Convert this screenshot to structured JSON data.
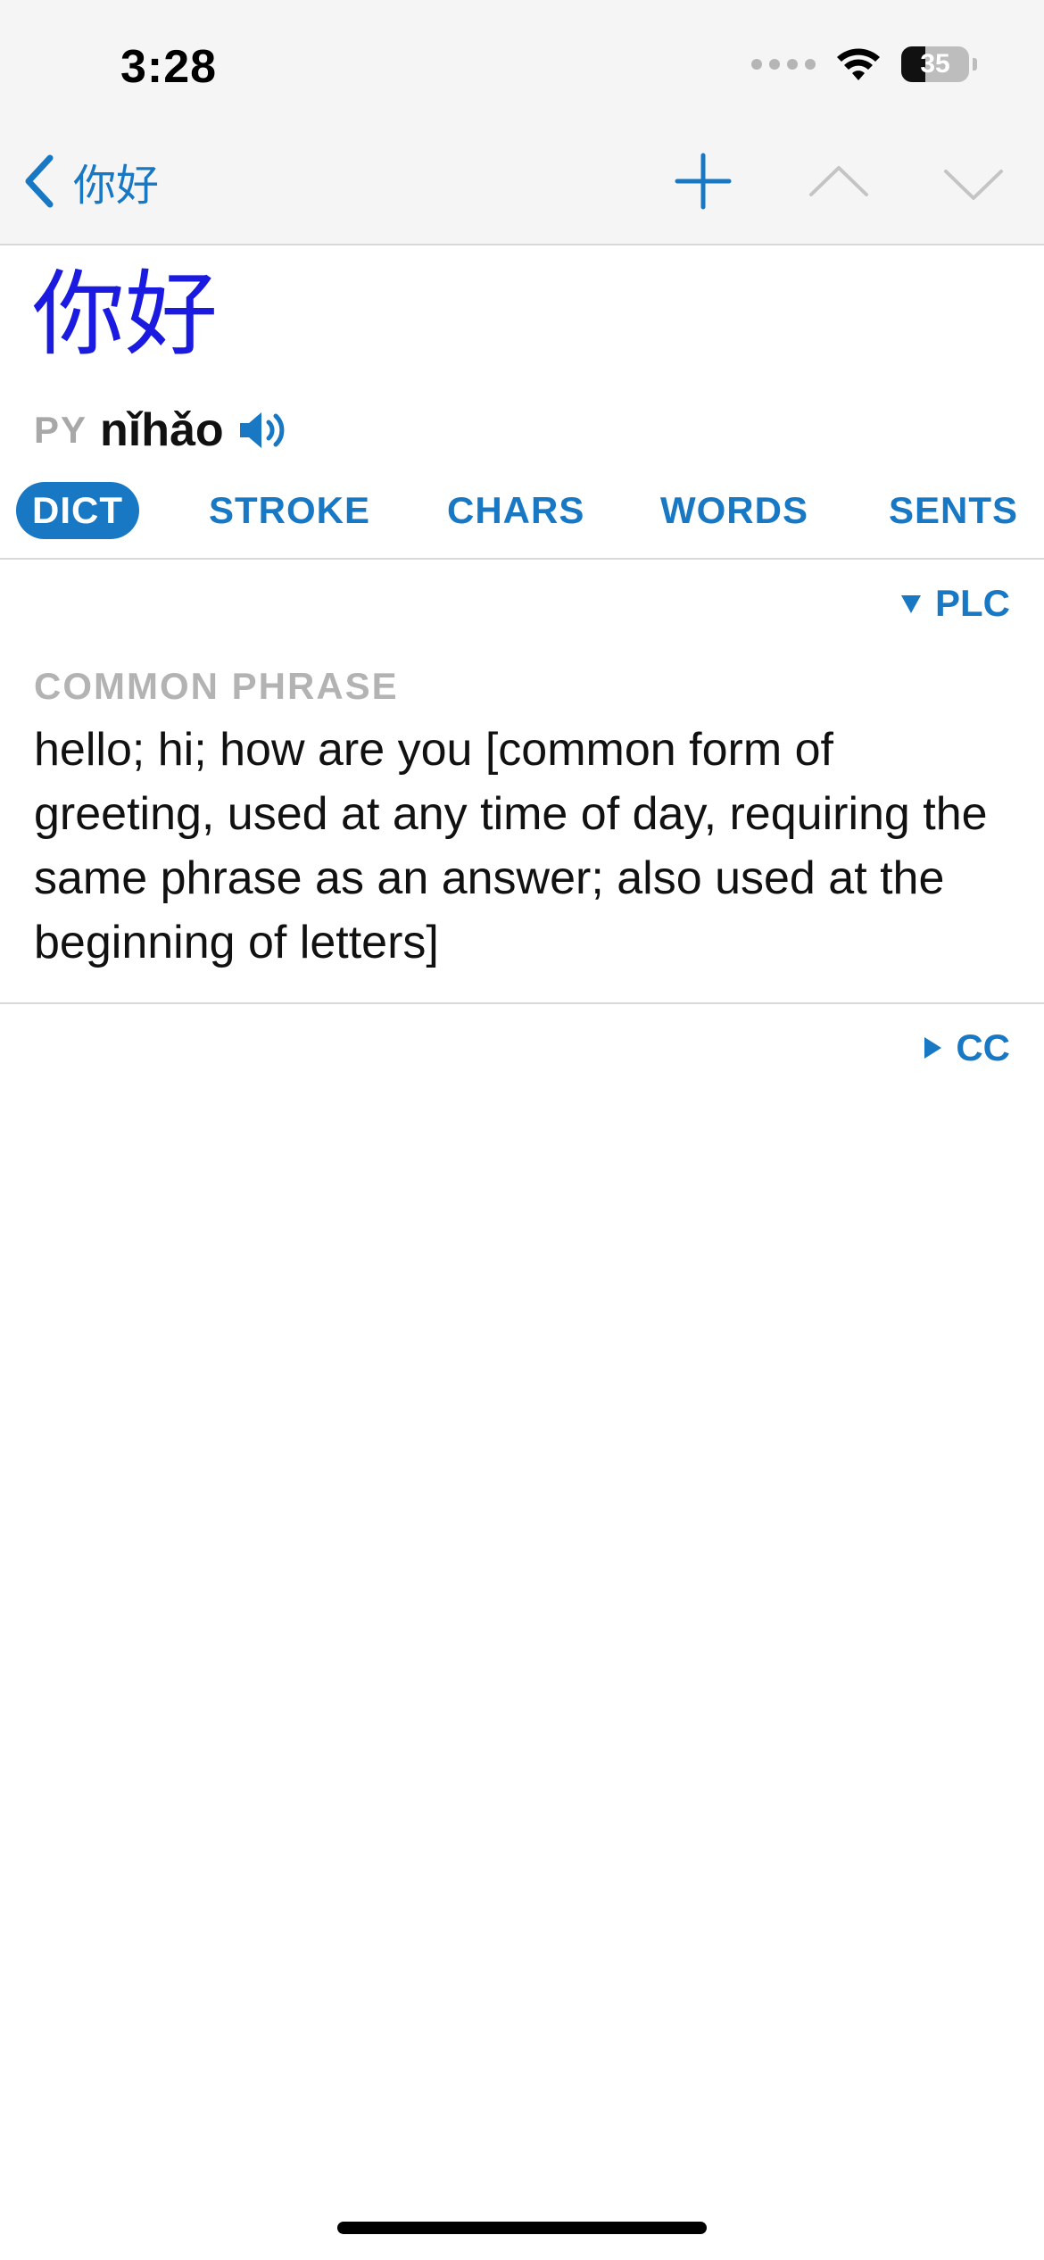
{
  "status_bar": {
    "time": "3:28",
    "battery": "35",
    "icons": [
      "signal-dots-icon",
      "wifi-icon",
      "battery-icon"
    ]
  },
  "nav": {
    "back_label": "你好",
    "icons": [
      "chevron-left-icon",
      "plus-icon",
      "chevron-up-icon",
      "chevron-down-icon"
    ]
  },
  "entry": {
    "headword": "你好",
    "pinyin_label": "PY",
    "pinyin": "nǐhǎo"
  },
  "tabs": [
    {
      "label": "DICT",
      "active": true
    },
    {
      "label": "STROKE",
      "active": false
    },
    {
      "label": "CHARS",
      "active": false
    },
    {
      "label": "WORDS",
      "active": false
    },
    {
      "label": "SENTS",
      "active": false
    }
  ],
  "sections": {
    "plc": {
      "label": "PLC",
      "expanded": true
    },
    "cc": {
      "label": "CC",
      "expanded": false
    }
  },
  "definition": {
    "category": "COMMON PHRASE",
    "text": "hello; hi; how are you [common form of greeting, used at any time of day, requiring the same phrase as an answer; also used at the beginning of letters]"
  },
  "colors": {
    "accent": "#1878c4",
    "headword": "#1a1ae0",
    "muted": "#b3b3b3"
  }
}
